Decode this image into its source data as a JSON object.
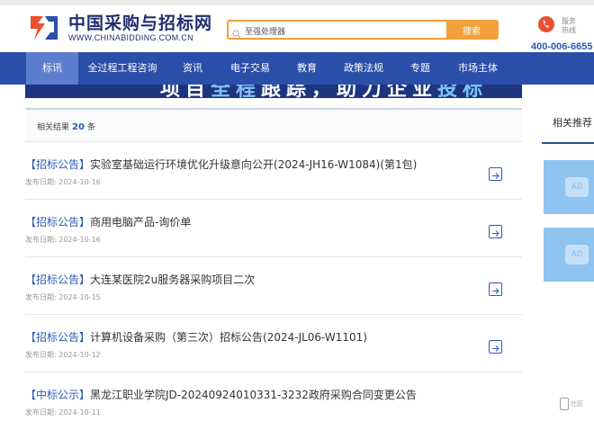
{
  "header": {
    "logo_cn": "中国采购与招标网",
    "logo_en": "WWW.CHINABIDDING.COM.CN",
    "search_value": "至强处理器",
    "search_button": "搜索",
    "hotline_label": "服务热线",
    "hotline_number": "400-006-6655"
  },
  "nav": {
    "items": [
      "标讯",
      "全过程工程咨询",
      "资讯",
      "电子交易",
      "教育",
      "政策法规",
      "专题",
      "市场主体"
    ],
    "active": "标讯"
  },
  "banner": {
    "text_part1": "项目",
    "text_part2": "全程",
    "text_part3": "跟踪，助力企业",
    "text_part4": "投标"
  },
  "results": {
    "prefix": "相关结果",
    "count": "20",
    "suffix": "条"
  },
  "list": [
    {
      "tag": "【招标公告】",
      "title": "实验室基础运行环境优化升级意向公开(2024-JH16-W1084)(第1包)",
      "date_label": "发布日期:",
      "date": "2024-10-16"
    },
    {
      "tag": "【招标公告】",
      "title": "商用电脑产品-询价单",
      "date_label": "发布日期:",
      "date": "2024-10-16"
    },
    {
      "tag": "【招标公告】",
      "title": "大连某医院2u服务器采购项目二次",
      "date_label": "发布日期:",
      "date": "2024-10-15"
    },
    {
      "tag": "【招标公告】",
      "title": "计算机设备采购（第三次）招标公告(2024-JL06-W1101)",
      "date_label": "发布日期:",
      "date": "2024-10-12"
    },
    {
      "tag": "【中标公示】",
      "title": "黑龙江职业学院JD-20240924010331-3232政府采购合同变更公告",
      "date_label": "发布日期:",
      "date": "2024-10-11"
    }
  ],
  "sidebar": {
    "title": "相关推荐",
    "ads": [
      "AD",
      "AD"
    ]
  },
  "watermark": {
    "text": "社区"
  },
  "colors": {
    "nav_bg": "#2b4fa8",
    "nav_active": "#5b7ed0",
    "accent_orange": "#f2a03a",
    "link_blue": "#2d5ab3",
    "ad_bg": "#8fc3f0"
  }
}
